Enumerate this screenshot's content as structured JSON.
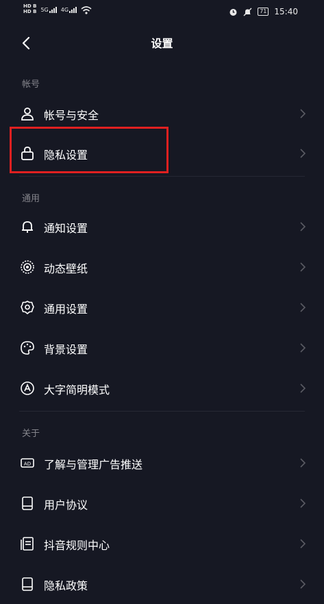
{
  "status_bar": {
    "hd_top": "HD B",
    "hd_bottom": "HD B",
    "net1": "5G",
    "net2": "4G",
    "battery": "71",
    "time": "15:40",
    "icons": [
      "alarm-icon",
      "mute-icon",
      "wifi-icon"
    ]
  },
  "header": {
    "title": "设置",
    "back_icon": "chevron-left-icon"
  },
  "sections": [
    {
      "label": "帐号",
      "items": [
        {
          "label": "帐号与安全",
          "icon": "user-icon"
        },
        {
          "label": "隐私设置",
          "icon": "lock-icon"
        }
      ]
    },
    {
      "label": "通用",
      "items": [
        {
          "label": "通知设置",
          "icon": "bell-icon"
        },
        {
          "label": "动态壁纸",
          "icon": "wallpaper-icon"
        },
        {
          "label": "通用设置",
          "icon": "gear-icon"
        },
        {
          "label": "背景设置",
          "icon": "palette-icon"
        },
        {
          "label": "大字简明模式",
          "icon": "large-text-icon"
        }
      ]
    },
    {
      "label": "关于",
      "items": [
        {
          "label": "了解与管理广告推送",
          "icon": "ad-icon"
        },
        {
          "label": "用户协议",
          "icon": "document-icon"
        },
        {
          "label": "抖音规则中心",
          "icon": "rules-icon"
        },
        {
          "label": "隐私政策",
          "icon": "privacy-icon"
        }
      ]
    }
  ],
  "colors": {
    "background": "#161823",
    "text_primary": "#ffffff",
    "text_secondary": "#85858c",
    "highlight": "#e02020"
  }
}
